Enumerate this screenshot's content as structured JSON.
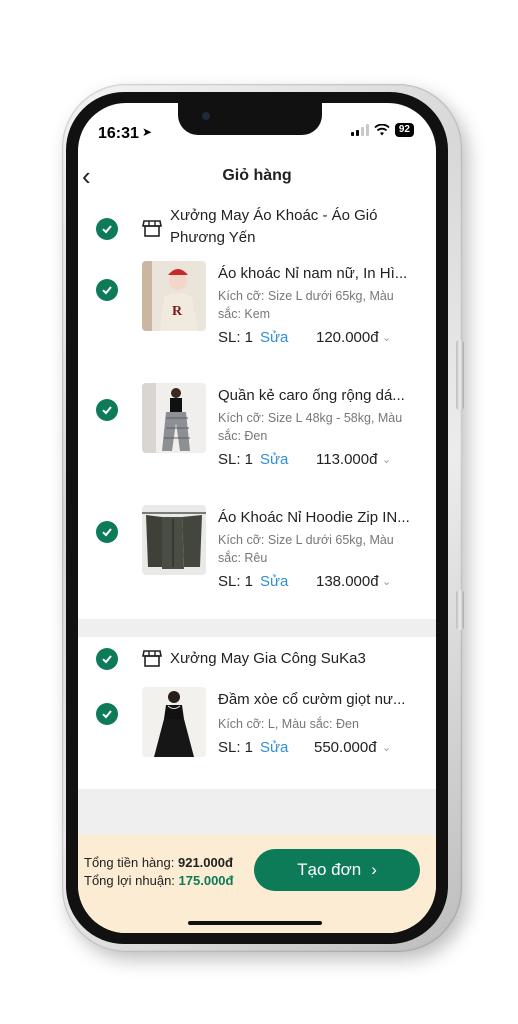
{
  "status_bar": {
    "time": "16:31",
    "battery": "92"
  },
  "header": {
    "title": "Giỏ hàng"
  },
  "shops": [
    {
      "name": "Xưởng May Áo Khoác - Áo Gió Phương Yến",
      "items": [
        {
          "name": "Áo khoác Nỉ nam nữ, In Hì...",
          "attributes": "Kích cỡ: Size L dưới 65kg, Màu sắc: Kem",
          "qty": "SL: 1",
          "edit": "Sửa",
          "price": "120.000đ"
        },
        {
          "name": "Quần kẻ caro ống rộng dá...",
          "attributes": "Kích cỡ: Size L 48kg - 58kg, Màu sắc: Đen",
          "qty": "SL: 1",
          "edit": "Sửa",
          "price": "113.000đ"
        },
        {
          "name": "Áo Khoác Nỉ Hoodie Zip IN...",
          "attributes": "Kích cỡ: Size L dưới 65kg, Màu sắc: Rêu",
          "qty": "SL: 1",
          "edit": "Sửa",
          "price": "138.000đ"
        }
      ]
    },
    {
      "name": "Xưởng May Gia Công SuKa3",
      "items": [
        {
          "name": "Đầm xòe cổ cườm giọt nư...",
          "attributes": "Kích cỡ: L, Màu sắc: Đen",
          "qty": "SL: 1",
          "edit": "Sửa",
          "price": "550.000đ"
        }
      ]
    }
  ],
  "footer": {
    "total_label": "Tổng tiền hàng:",
    "total_value": "921.000đ",
    "profit_label": "Tổng lợi nhuận:",
    "profit_value": "175.000đ",
    "create_button": "Tạo đơn"
  },
  "colors": {
    "accent": "#0d7a58",
    "link": "#2f8fd6",
    "footer_bg": "#fcecd3"
  },
  "icons": [
    "back-arrow-icon",
    "location-arrow-icon",
    "wifi-icon",
    "signal-icon",
    "check-circle-icon",
    "shop-icon",
    "chevron-down-icon",
    "chevron-right-icon"
  ]
}
